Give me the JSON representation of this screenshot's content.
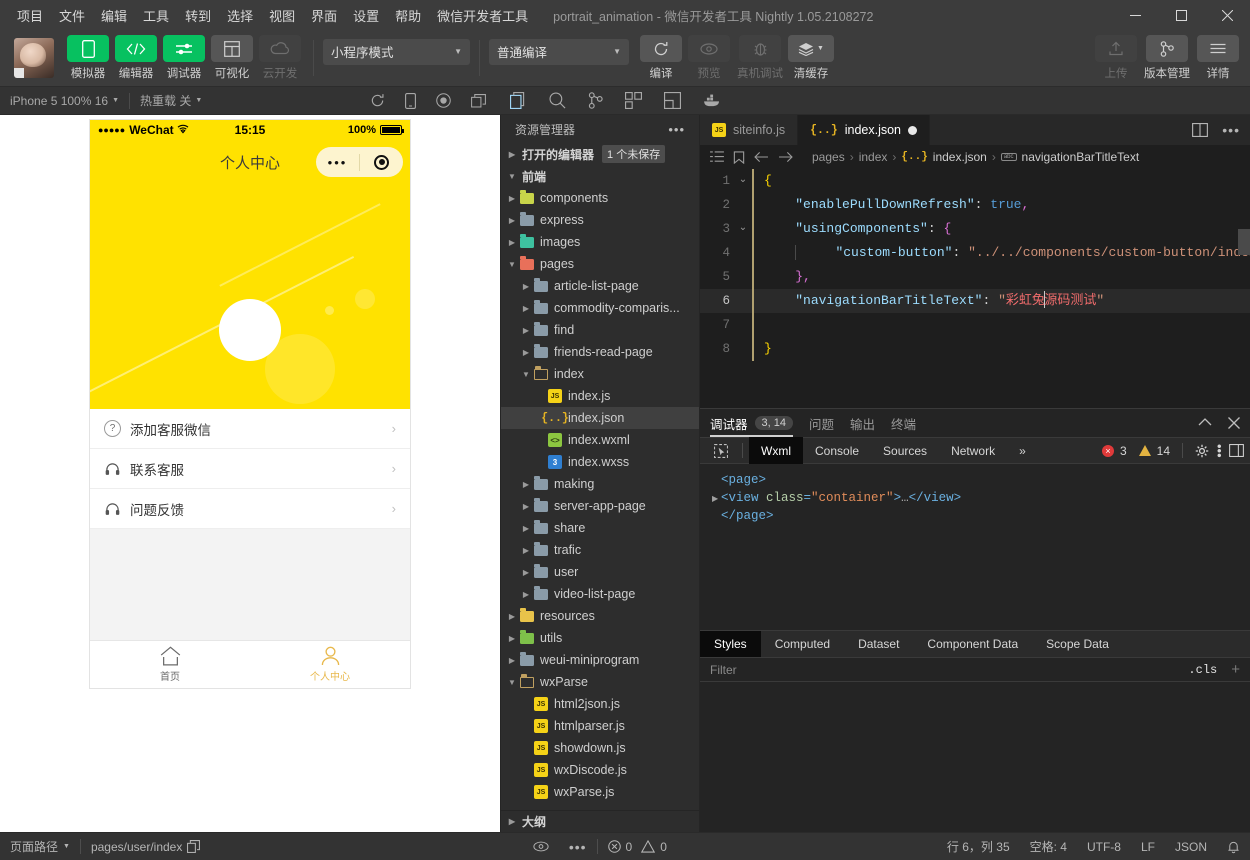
{
  "titlebar": {
    "menus": [
      "项目",
      "文件",
      "编辑",
      "工具",
      "转到",
      "选择",
      "视图",
      "界面",
      "设置",
      "帮助",
      "微信开发者工具"
    ],
    "title": "portrait_animation - 微信开发者工具 Nightly 1.05.2108272",
    "minimize": "minimize-icon",
    "maximize": "maximize-icon",
    "close": "close-icon"
  },
  "toolbar": {
    "buttons": [
      {
        "label": "模拟器",
        "icon": "phone-icon",
        "style": "green"
      },
      {
        "label": "编辑器",
        "icon": "code-icon",
        "style": "green"
      },
      {
        "label": "调试器",
        "icon": "sliders-icon",
        "style": "green"
      },
      {
        "label": "可视化",
        "icon": "layout-icon",
        "style": "grey"
      },
      {
        "label": "云开发",
        "icon": "cloud-icon",
        "style": "dim"
      }
    ],
    "mode_select": "小程序模式",
    "compile_select": "普通编译",
    "actions": [
      {
        "label": "编译",
        "icon": "refresh-icon",
        "style": "grey"
      },
      {
        "label": "预览",
        "icon": "eye-icon",
        "style": "dim"
      },
      {
        "label": "真机调试",
        "icon": "bug-icon",
        "style": "dim"
      },
      {
        "label": "清缓存",
        "icon": "layers-icon",
        "style": "grey"
      }
    ],
    "right_actions": [
      {
        "label": "上传",
        "icon": "upload-icon",
        "style": "dim"
      },
      {
        "label": "版本管理",
        "icon": "git-branch-icon",
        "style": "grey"
      },
      {
        "label": "详情",
        "icon": "hamburger-icon",
        "style": "grey"
      }
    ]
  },
  "subbar": {
    "device": "iPhone 5 100% 16",
    "hot_reload": "热重载 关",
    "sim_icons": [
      "refresh-icon",
      "rotate-device-icon",
      "record-icon",
      "popout-icon"
    ],
    "editor_icons": [
      "copy-files-icon",
      "search-icon",
      "source-control-icon",
      "extensions-icon",
      "snippet-icon",
      "docker-icon"
    ]
  },
  "simulator": {
    "status": {
      "carrier": "WeChat",
      "time": "15:15",
      "battery": "100%"
    },
    "nav_title": "个人中心",
    "list": [
      {
        "label": "添加客服微信",
        "icon": "question-circle-icon"
      },
      {
        "label": "联系客服",
        "icon": "headset-icon"
      },
      {
        "label": "问题反馈",
        "icon": "headset-icon"
      }
    ],
    "tabs": [
      {
        "label": "首页",
        "icon": "home-icon",
        "active": false
      },
      {
        "label": "个人中心",
        "icon": "person-icon",
        "active": true
      }
    ]
  },
  "explorer": {
    "title": "资源管理器",
    "more_icon": "ellipsis-icon",
    "open_editors": {
      "label": "打开的编辑器",
      "badge": "1 个未保存"
    },
    "root": "前端",
    "outline": "大纲",
    "tree": [
      {
        "name": "components",
        "type": "folder-components",
        "depth": 1,
        "open": false
      },
      {
        "name": "express",
        "type": "folder",
        "depth": 1,
        "open": false
      },
      {
        "name": "images",
        "type": "folder-images",
        "depth": 1,
        "open": false
      },
      {
        "name": "pages",
        "type": "folder-pages",
        "depth": 1,
        "open": true
      },
      {
        "name": "article-list-page",
        "type": "folder",
        "depth": 2,
        "open": false
      },
      {
        "name": "commodity-comparis...",
        "type": "folder",
        "depth": 2,
        "open": false
      },
      {
        "name": "find",
        "type": "folder",
        "depth": 2,
        "open": false
      },
      {
        "name": "friends-read-page",
        "type": "folder",
        "depth": 2,
        "open": false
      },
      {
        "name": "index",
        "type": "folder-open",
        "depth": 2,
        "open": true
      },
      {
        "name": "index.js",
        "type": "js",
        "depth": 3,
        "open": false
      },
      {
        "name": "index.json",
        "type": "json",
        "depth": 3,
        "open": false,
        "selected": true
      },
      {
        "name": "index.wxml",
        "type": "wxml",
        "depth": 3,
        "open": false
      },
      {
        "name": "index.wxss",
        "type": "wxss",
        "depth": 3,
        "open": false
      },
      {
        "name": "making",
        "type": "folder",
        "depth": 2,
        "open": false
      },
      {
        "name": "server-app-page",
        "type": "folder",
        "depth": 2,
        "open": false
      },
      {
        "name": "share",
        "type": "folder",
        "depth": 2,
        "open": false
      },
      {
        "name": "trafic",
        "type": "folder",
        "depth": 2,
        "open": false
      },
      {
        "name": "user",
        "type": "folder",
        "depth": 2,
        "open": false
      },
      {
        "name": "video-list-page",
        "type": "folder",
        "depth": 2,
        "open": false
      },
      {
        "name": "resources",
        "type": "folder-resources",
        "depth": 1,
        "open": false
      },
      {
        "name": "utils",
        "type": "folder-utils",
        "depth": 1,
        "open": false
      },
      {
        "name": "weui-miniprogram",
        "type": "folder",
        "depth": 1,
        "open": false
      },
      {
        "name": "wxParse",
        "type": "folder-open",
        "depth": 1,
        "open": true
      },
      {
        "name": "html2json.js",
        "type": "js",
        "depth": 2,
        "open": false
      },
      {
        "name": "htmlparser.js",
        "type": "js",
        "depth": 2,
        "open": false
      },
      {
        "name": "showdown.js",
        "type": "js",
        "depth": 2,
        "open": false
      },
      {
        "name": "wxDiscode.js",
        "type": "js",
        "depth": 2,
        "open": false
      },
      {
        "name": "wxParse.js",
        "type": "js",
        "depth": 2,
        "open": false
      }
    ]
  },
  "editor": {
    "tabs": [
      {
        "label": "siteinfo.js",
        "icon": "js-file-icon",
        "active": false,
        "dirty": false
      },
      {
        "label": "index.json",
        "icon": "json-file-icon",
        "active": true,
        "dirty": true
      }
    ],
    "tab_actions": [
      "split-editor-icon",
      "more-actions-icon"
    ],
    "breadcrumb_icons": [
      "outline-icon",
      "bookmark-icon",
      "back-arrow-icon",
      "forward-arrow-icon"
    ],
    "breadcrumb": [
      "pages",
      "index",
      "index.json",
      "navigationBarTitleText"
    ],
    "lines": [
      {
        "num": "1",
        "fold": "v",
        "text": "{",
        "bar": true
      },
      {
        "num": "2",
        "fold": "",
        "text": "    \"enablePullDownRefresh\": true,",
        "bar": true
      },
      {
        "num": "3",
        "fold": "v",
        "text": "    \"usingComponents\": {",
        "bar": true
      },
      {
        "num": "4",
        "fold": "",
        "text": "        \"custom-button\": \"../../components/custom-button/index\"",
        "bar": true
      },
      {
        "num": "5",
        "fold": "",
        "text": "    },",
        "bar": true
      },
      {
        "num": "6",
        "fold": "",
        "text": "    \"navigationBarTitleText\": \"彩虹兔源码测试\"",
        "bar": true,
        "highlight": true
      },
      {
        "num": "7",
        "fold": "",
        "text": "",
        "bar": true
      },
      {
        "num": "8",
        "fold": "",
        "text": "}",
        "bar": true
      }
    ]
  },
  "debugger": {
    "tabs": [
      {
        "label": "调试器",
        "badge": "3, 14",
        "active": true
      },
      {
        "label": "问题",
        "badge": "",
        "active": false
      },
      {
        "label": "输出",
        "badge": "",
        "active": false
      },
      {
        "label": "终端",
        "badge": "",
        "active": false
      }
    ],
    "panel_actions": [
      "collapse-icon",
      "close-icon"
    ],
    "devtools_tabs": [
      "Wxml",
      "Console",
      "Sources",
      "Network"
    ],
    "devtools_more": "»",
    "inspect_icon": "inspect-element-icon",
    "error_count": "3",
    "warning_count": "14",
    "devtools_actions": [
      "settings-gear-icon",
      "more-vertical-icon",
      "dock-side-icon"
    ],
    "dom": [
      {
        "text": "<page>",
        "indent": 0,
        "arrow": false
      },
      {
        "text": "<view class=\"container\">…</view>",
        "indent": 0,
        "arrow": true
      },
      {
        "text": "</page>",
        "indent": 0,
        "arrow": false
      }
    ],
    "styles_tabs": [
      "Styles",
      "Computed",
      "Dataset",
      "Component Data",
      "Scope Data"
    ],
    "filter_placeholder": "Filter",
    "cls_label": ".cls",
    "add_icon": "plus-icon"
  },
  "statusbar": {
    "page_path_label": "页面路径",
    "page_path": "pages/user/index",
    "copy_icon": "copy-icon",
    "eye_icon": "eye-icon",
    "more_icon": "ellipsis-icon",
    "errors": "0",
    "warnings": "0",
    "cursor": "行 6，列 35",
    "spaces": "空格: 4",
    "encoding": "UTF-8",
    "eol": "LF",
    "language": "JSON",
    "bell_icon": "bell-icon"
  },
  "colors": {
    "accent": "#07c160",
    "yellow": "#ffe200",
    "error": "#e03a3a",
    "warning": "#e3b341"
  }
}
